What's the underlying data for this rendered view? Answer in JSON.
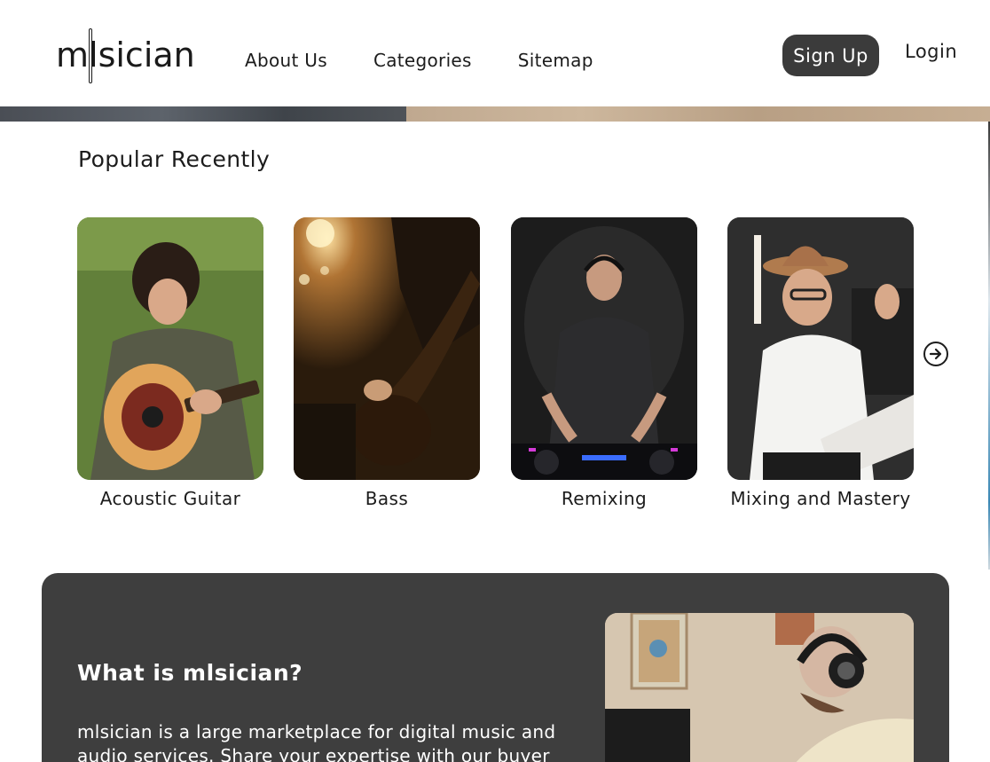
{
  "header": {
    "logo_text": "mlsician",
    "nav": [
      "About Us",
      "Categories",
      "Sitemap"
    ],
    "signup_label": "Sign Up",
    "login_label": "Login"
  },
  "popular": {
    "title": "Popular Recently",
    "items": [
      {
        "label": "Acoustic Guitar",
        "image": "young man playing acoustic guitar on grass"
      },
      {
        "label": "Bass",
        "image": "close-up of hands playing bass guitar"
      },
      {
        "label": "Remixing",
        "image": "DJ with headphones at mixing console"
      },
      {
        "label": "Mixing and Mastery",
        "image": "smiling man in hat giving thumbs up at studio keyboard"
      }
    ],
    "next_icon": "arrow-right-circle-icon"
  },
  "about": {
    "title": "What is mlsician?",
    "text": "mlsician is a large marketplace for digital music and audio services. Share your expertise with our buyer",
    "image": "man with headphones working at studio"
  },
  "colors": {
    "primary_dark": "#3b3b3b",
    "panel_bg": "#3e3e3e",
    "text": "#1c1c1c"
  }
}
